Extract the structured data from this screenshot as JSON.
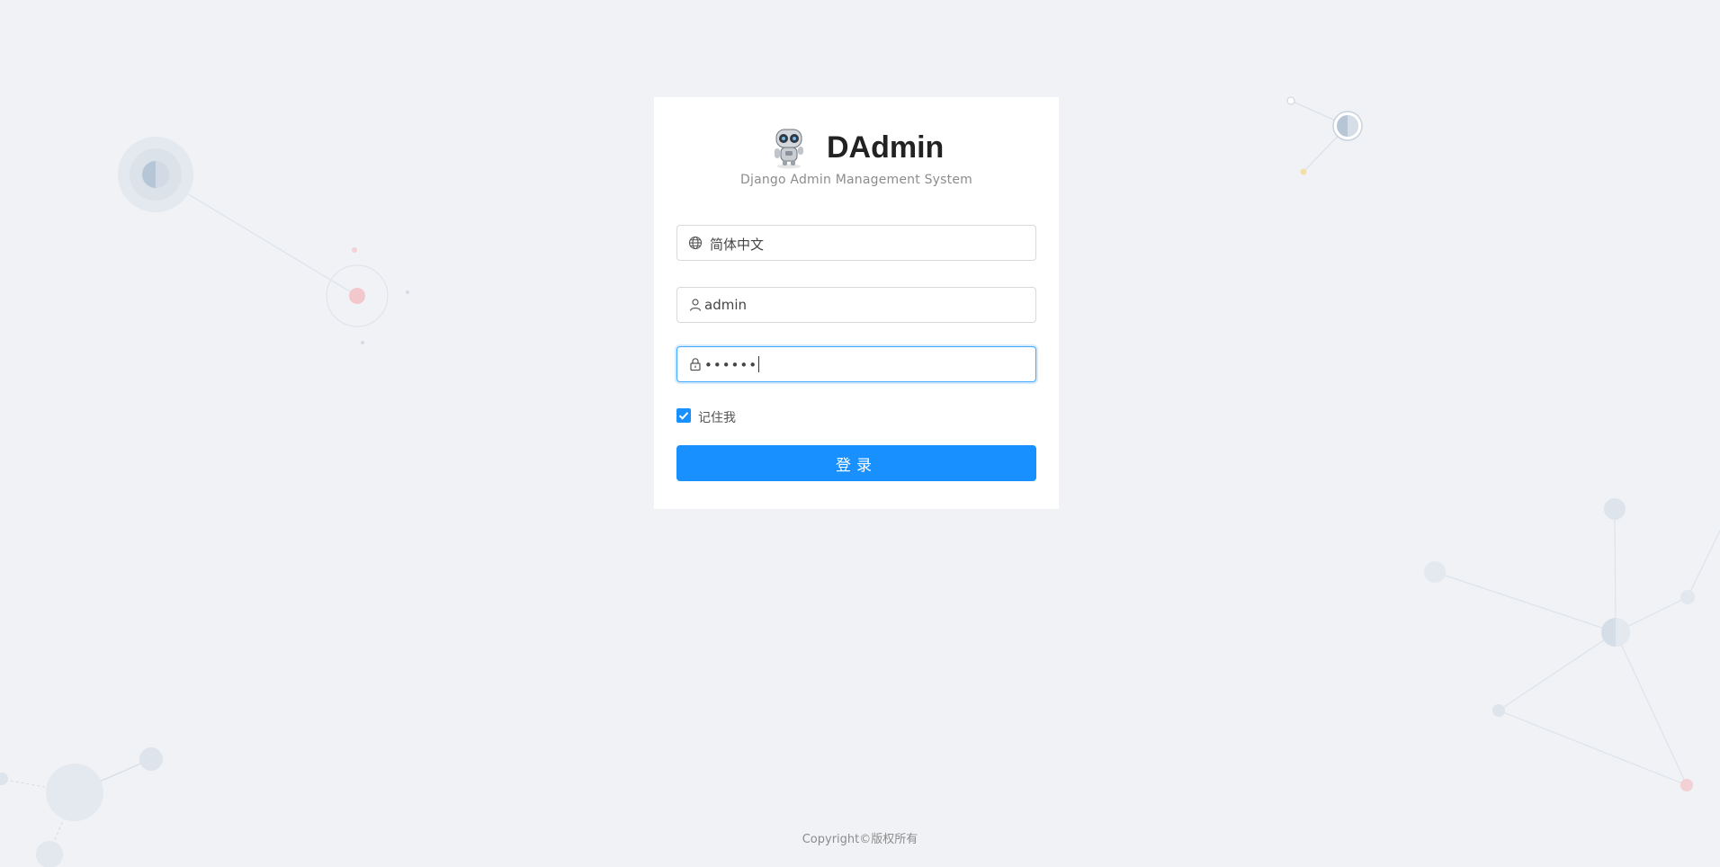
{
  "app": {
    "title": "DAdmin",
    "subtitle": "Django Admin Management System"
  },
  "form": {
    "language": {
      "value": "简体中文",
      "icon": "globe-icon"
    },
    "username": {
      "value": "admin",
      "icon": "user-icon"
    },
    "password": {
      "value": "••••••",
      "icon": "lock-icon"
    },
    "remember": {
      "label": "记住我",
      "checked": true
    },
    "submit_label": "登录"
  },
  "footer": {
    "copyright": "Copyright©版权所有"
  },
  "colors": {
    "background": "#f0f2f5",
    "primary": "#1890ff",
    "card": "#ffffff"
  }
}
